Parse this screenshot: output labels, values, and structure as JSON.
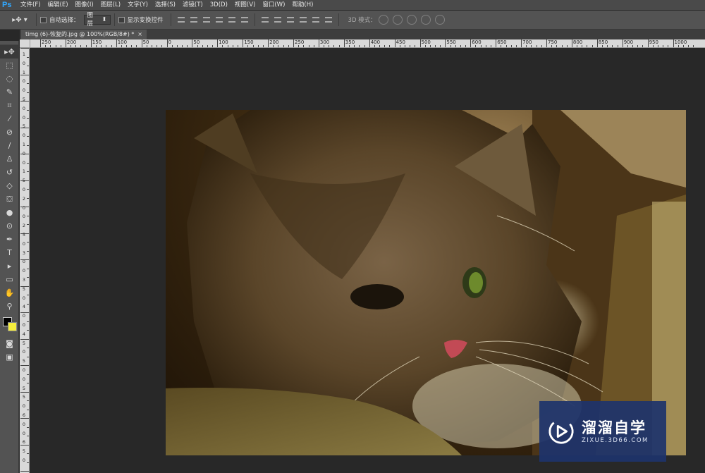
{
  "app": {
    "logo": "Ps"
  },
  "menubar": {
    "items": [
      "文件(F)",
      "编辑(E)",
      "图像(I)",
      "图层(L)",
      "文字(Y)",
      "选择(S)",
      "滤镜(T)",
      "3D(D)",
      "视图(V)",
      "窗口(W)",
      "帮助(H)"
    ]
  },
  "options": {
    "tool_glyph": "▸✥ ▾",
    "auto_select_label": "自动选择：",
    "auto_select_value": "图层",
    "show_transform_label": "显示变换控件",
    "mode_3d_label": "3D 模式："
  },
  "document": {
    "tab_title": "timg (6)-恢复的.jpg @ 100%(RGB/8#) *",
    "close_glyph": "×"
  },
  "ruler": {
    "top_labels": [
      "250",
      "200",
      "150",
      "100",
      "50",
      "0",
      "50",
      "100",
      "150",
      "200",
      "250",
      "300",
      "350",
      "400",
      "450",
      "500",
      "550",
      "600",
      "650",
      "700",
      "750",
      "800",
      "850",
      "900",
      "950",
      "1000"
    ],
    "left_labels": [
      "1",
      "0",
      "1",
      "0",
      "0",
      "5",
      "0",
      "0",
      "5",
      "0",
      "1",
      "0",
      "0",
      "1",
      "5",
      "0",
      "2",
      "0",
      "0",
      "2",
      "5",
      "0",
      "3",
      "0",
      "0",
      "3",
      "5",
      "0",
      "4",
      "0",
      "0",
      "4",
      "5",
      "0",
      "5",
      "0",
      "0",
      "5",
      "5",
      "0",
      "6",
      "0",
      "0",
      "6",
      "5",
      "0"
    ]
  },
  "tools": [
    {
      "name": "move-tool-icon",
      "glyph": "▸✥"
    },
    {
      "name": "marquee-tool-icon",
      "glyph": "⬚"
    },
    {
      "name": "lasso-tool-icon",
      "glyph": "◌"
    },
    {
      "name": "quick-select-tool-icon",
      "glyph": "✎"
    },
    {
      "name": "crop-tool-icon",
      "glyph": "⌗"
    },
    {
      "name": "eyedropper-tool-icon",
      "glyph": "⁄"
    },
    {
      "name": "healing-brush-tool-icon",
      "glyph": "⊘"
    },
    {
      "name": "brush-tool-icon",
      "glyph": "∕"
    },
    {
      "name": "clone-stamp-tool-icon",
      "glyph": "♙"
    },
    {
      "name": "history-brush-tool-icon",
      "glyph": "↺"
    },
    {
      "name": "eraser-tool-icon",
      "glyph": "◇"
    },
    {
      "name": "paint-bucket-tool-icon",
      "glyph": "⛋"
    },
    {
      "name": "blur-tool-icon",
      "glyph": "●"
    },
    {
      "name": "dodge-tool-icon",
      "glyph": "⊙"
    },
    {
      "name": "pen-tool-icon",
      "glyph": "✒"
    },
    {
      "name": "type-tool-icon",
      "glyph": "T"
    },
    {
      "name": "path-select-tool-icon",
      "glyph": "▸"
    },
    {
      "name": "shape-tool-icon",
      "glyph": "▭"
    },
    {
      "name": "hand-tool-icon",
      "glyph": "✋"
    },
    {
      "name": "zoom-tool-icon",
      "glyph": "⚲"
    }
  ],
  "bottom_tools": [
    {
      "name": "quick-mask-icon",
      "glyph": "◙"
    },
    {
      "name": "screen-mode-icon",
      "glyph": "▣"
    }
  ],
  "colors": {
    "foreground": "#000000",
    "background": "#f6ee3d"
  },
  "watermark": {
    "title": "溜溜自学",
    "subtitle": "ZIXUE.3D66.COM"
  }
}
